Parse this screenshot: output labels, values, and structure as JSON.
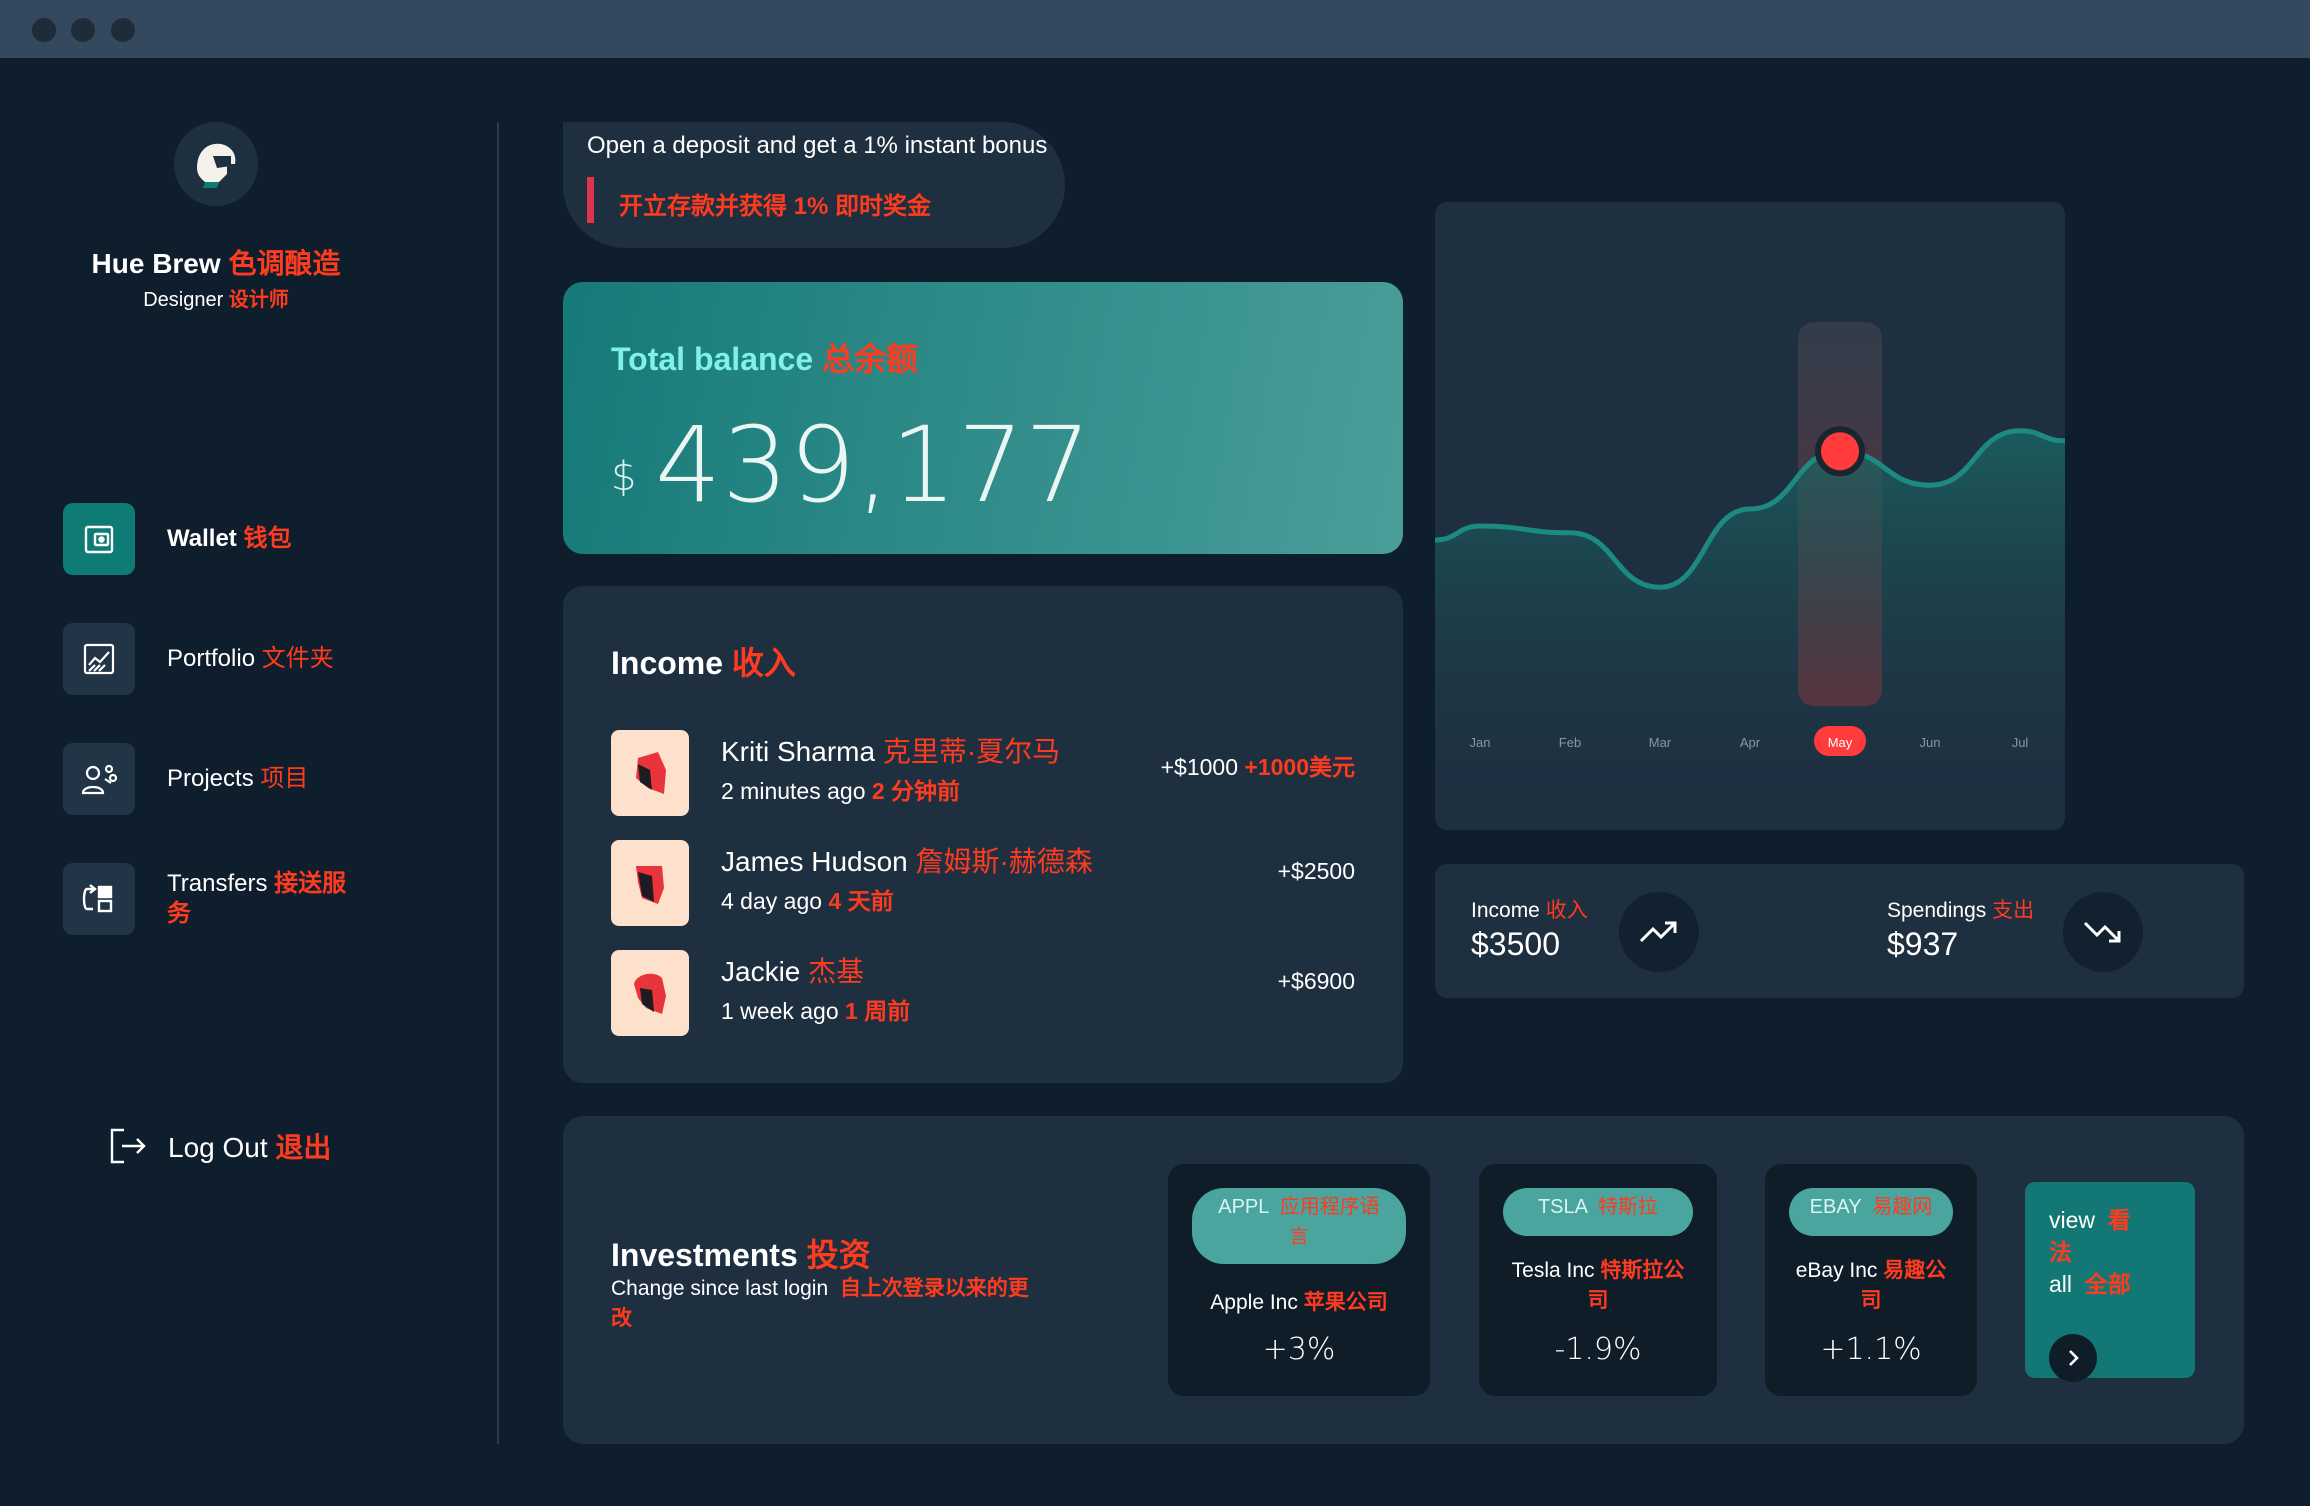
{
  "window": {
    "controls": [
      "close",
      "minimize",
      "maximize"
    ]
  },
  "profile": {
    "name": "Hue Brew",
    "name_zh": "色调酿造",
    "role": "Designer",
    "role_zh": "设计师",
    "avatar_icon": "helmet-avatar-icon"
  },
  "sidebar": {
    "items": [
      {
        "label": "Wallet",
        "label_zh": "钱包",
        "icon": "wallet-icon",
        "active": true
      },
      {
        "label": "Portfolio",
        "label_zh": "文件夹",
        "icon": "chart-icon",
        "active": false
      },
      {
        "label": "Projects",
        "label_zh": "项目",
        "icon": "team-icon",
        "active": false
      },
      {
        "label": "Transfers",
        "label_zh": "接送服",
        "label_zh_2": "务",
        "icon": "transfer-icon",
        "active": false
      }
    ],
    "logout": {
      "label": "Log Out",
      "label_zh": "退出",
      "icon": "logout-icon"
    }
  },
  "bonus": {
    "text": "Open a deposit and get a 1% instant bonus",
    "text_zh": "开立存款并获得 1% 即时奖金"
  },
  "balance": {
    "title": "Total balance",
    "title_zh": "总余额",
    "currency": "$",
    "amount": "439,177"
  },
  "income": {
    "title": "Income",
    "title_zh": "收入",
    "rows": [
      {
        "name": "Kriti Sharma",
        "name_zh": "克里蒂·夏尔马",
        "time": "2 minutes ago",
        "time_zh": "2 分钟前",
        "amount": "+$1000",
        "amount_zh": "+1000美元"
      },
      {
        "name": "James Hudson",
        "name_zh": "詹姆斯·赫德森",
        "time": "4 day ago",
        "time_zh": "4 天前",
        "amount": "+$2500",
        "amount_zh": ""
      },
      {
        "name": "Jackie",
        "name_zh": "杰基",
        "time": "1 week ago",
        "time_zh": "1 周前",
        "amount": "+$6900",
        "amount_zh": ""
      }
    ]
  },
  "chart_data": {
    "type": "area",
    "title": "",
    "xlabel": "",
    "ylabel": "",
    "categories": [
      "Jan",
      "Feb",
      "Mar",
      "Apr",
      "May",
      "Jun",
      "Jul"
    ],
    "highlight": "May",
    "series": [
      {
        "values": [
          40,
          38,
          22,
          45,
          62,
          52,
          68
        ]
      }
    ],
    "ylim": [
      0,
      100
    ],
    "grid": false,
    "colors": {
      "line": "#1c8a80",
      "marker": "#ff3b3b",
      "highlight": "#ff3b3b"
    }
  },
  "stats": {
    "income": {
      "label": "Income",
      "label_zh": "收入",
      "value": "$3500",
      "icon": "trend-up-icon"
    },
    "spendings": {
      "label": "Spendings",
      "label_zh": "支出",
      "value": "$937",
      "icon": "trend-down-icon"
    }
  },
  "investments": {
    "title": "Investments",
    "title_zh": "投资",
    "subtitle": "Change since last login",
    "subtitle_zh": "自上次登录以来的更",
    "subtitle_zh_2": "改",
    "stocks": [
      {
        "ticker": "APPL",
        "ticker_zh": "应用程序语",
        "ticker_zh_2": "言",
        "company": "Apple Inc",
        "company_zh": "苹果公司",
        "company_zh_2": "",
        "change": "+3%"
      },
      {
        "ticker": "TSLA",
        "ticker_zh": "特斯拉",
        "ticker_zh_2": "",
        "company": "Tesla Inc",
        "company_zh": "特斯拉公",
        "company_zh_2": "司",
        "change": "-1.9%"
      },
      {
        "ticker": "EBAY",
        "ticker_zh": "易趣网",
        "ticker_zh_2": "",
        "company": "eBay Inc",
        "company_zh": "易趣公",
        "company_zh_2": "司",
        "change": "+1.1%"
      }
    ],
    "view_all": {
      "word1": "view",
      "word1_zh": "看",
      "word1_zh_2": "法",
      "word2": "all",
      "word2_zh": "全部",
      "icon": "chevron-right-icon"
    }
  },
  "colors": {
    "background": "#0f1e2c",
    "panel": "#1e2f40",
    "accent": "#0e7c74",
    "chinese_text": "#ff3b1f",
    "highlight_red": "#ff3b3b"
  }
}
